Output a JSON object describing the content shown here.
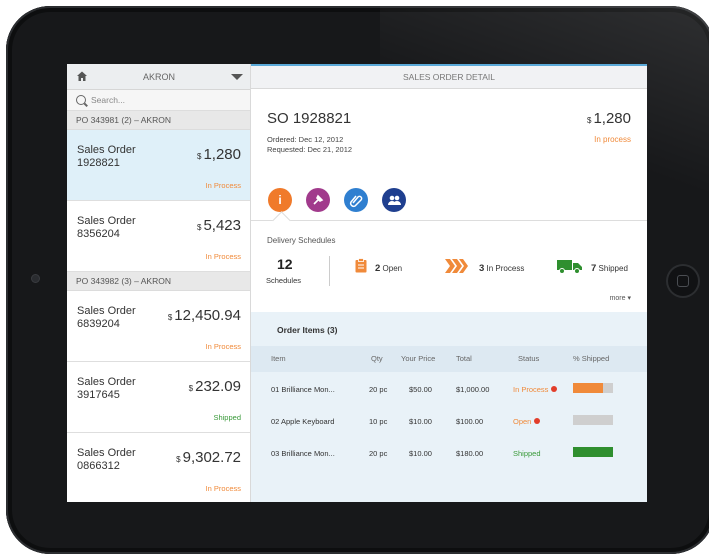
{
  "store": "AKRON",
  "search_placeholder": "Search...",
  "header_title": "SALES ORDER DETAIL",
  "groups": [
    {
      "label": "PO 343981 (2) – AKRON"
    },
    {
      "label": "PO 343982 (3) – AKRON"
    }
  ],
  "orders": [
    {
      "title": "Sales Order",
      "number": "1928821",
      "currency": "$",
      "amount": "1,280",
      "status": "In Process",
      "status_color": "#f08a3a",
      "selected": true
    },
    {
      "title": "Sales Order",
      "number": "8356204",
      "currency": "$",
      "amount": "5,423",
      "status": "In Process",
      "status_color": "#f08a3a"
    },
    {
      "title": "Sales Order",
      "number": "6839204",
      "currency": "$",
      "amount": "12,450.94",
      "status": "In Process",
      "status_color": "#f08a3a"
    },
    {
      "title": "Sales Order",
      "number": "3917645",
      "currency": "$",
      "amount": "232.09",
      "status": "Shipped",
      "status_color": "#3a9a3a"
    },
    {
      "title": "Sales Order",
      "number": "0866312",
      "currency": "$",
      "amount": "9,302.72",
      "status": "In Process",
      "status_color": "#f08a3a"
    }
  ],
  "detail": {
    "so_number": "SO 1928821",
    "currency": "$",
    "amount": "1,280",
    "ordered": "Ordered: Dec 12, 2012",
    "requested": "Requested: Dec 21, 2012",
    "status": "In process",
    "status_color": "#f08a3a",
    "icons": [
      {
        "name": "info-icon",
        "color": "#f07a2a"
      },
      {
        "name": "pin-icon",
        "color": "#a13a8c"
      },
      {
        "name": "attachment-icon",
        "color": "#2f7fd0"
      },
      {
        "name": "people-icon",
        "color": "#1f3f8f"
      }
    ]
  },
  "delivery": {
    "label": "Delivery Schedules",
    "count": "12",
    "count_label": "Schedules",
    "open_count": "2",
    "open_label": "Open",
    "in_process_count": "3",
    "in_process_label": "In Process",
    "shipped_count": "7",
    "shipped_label": "Shipped",
    "more_label": "more ▾"
  },
  "items": {
    "title": "Order Items",
    "count": "(3)",
    "headers": [
      "Item",
      "Qty",
      "Your Price",
      "Total",
      "Status",
      "% Shipped"
    ],
    "rows": [
      {
        "item": "01  Brilliance Mon...",
        "qty": "20 pc",
        "price": "$50.00",
        "total": "$1,000.00",
        "status": "In Process",
        "status_color": "#f08a3a",
        "clock": true,
        "shipped_fraction": 0.75,
        "bar_color": "#f08a3a"
      },
      {
        "item": "02  Apple Keyboard",
        "qty": "10 pc",
        "price": "$10.00",
        "total": "$100.00",
        "status": "Open",
        "status_color": "#f08a3a",
        "clock": true,
        "shipped_fraction": 0,
        "bar_color": "#f08a3a"
      },
      {
        "item": "03  Brilliance Mon...",
        "qty": "20 pc",
        "price": "$10.00",
        "total": "$180.00",
        "status": "Shipped",
        "status_color": "#3a9a3a",
        "clock": false,
        "shipped_fraction": 1.0,
        "bar_color": "#2f8f2f"
      }
    ]
  }
}
